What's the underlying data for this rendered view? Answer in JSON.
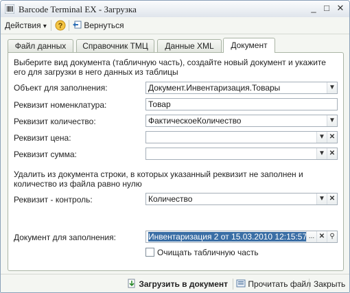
{
  "window": {
    "title": "Barcode Terminal EX - Загрузка",
    "minimize_glyph": "_",
    "maximize_glyph": "□",
    "close_glyph": "✕"
  },
  "toolbar": {
    "actions_label": "Действия",
    "actions_arrow": "▾",
    "help_glyph": "?",
    "back_label": "Вернуться"
  },
  "tabs": [
    {
      "label": "Файл данных",
      "active": false
    },
    {
      "label": "Справочник ТМЦ",
      "active": false
    },
    {
      "label": "Данные XML",
      "active": false
    },
    {
      "label": "Документ",
      "active": true
    }
  ],
  "document_tab": {
    "intro": "Выберите вид документа (табличную часть), создайте новый документ и укажите его для загрузки в него данных из таблицы",
    "object_label": "Объект для заполнения:",
    "object_value": "Документ.Инвентаризация.Товары",
    "nomenclature_label": "Реквизит номенклатура:",
    "nomenclature_value": "Товар",
    "quantity_label": "Реквизит количество:",
    "quantity_value": "ФактическоеКоличество",
    "price_label": "Реквизит цена:",
    "price_value": "",
    "sum_label": "Реквизит сумма:",
    "sum_value": "",
    "delete_note": "Удалить из документа строки, в которых указанный реквизит не заполнен и количество из файла равно нулю",
    "control_label": "Реквизит - контроль:",
    "control_value": "Количество",
    "document_label": "Документ для заполнения:",
    "document_value": "Инвентаризация 2 от 15.03.2010 12:15:57",
    "clear_table_label": "Очищать табличную часть",
    "clear_table_checked": false
  },
  "field_buttons": {
    "dropdown": "▼",
    "clear": "✕",
    "ellipsis": "...",
    "search": "⚲"
  },
  "statusbar": {
    "load_label": "Загрузить в документ",
    "read_label": "Прочитать файл",
    "close_label": "Закрыть"
  }
}
